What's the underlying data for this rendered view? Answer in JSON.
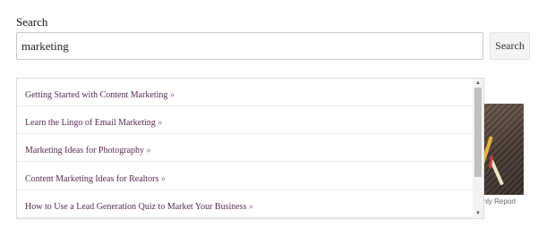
{
  "search": {
    "label": "Search",
    "value": "marketing",
    "button_label": "Search"
  },
  "suggestions": [
    {
      "title": "Getting Started with Content Marketing",
      "chevron": "»"
    },
    {
      "title": "Learn the Lingo of Email Marketing",
      "chevron": "»"
    },
    {
      "title": "Marketing Ideas for Photography",
      "chevron": "»"
    },
    {
      "title": "Content Marketing Ideas for Realtors",
      "chevron": "»"
    },
    {
      "title": "How to Use a Lead Generation Quiz to Market Your Business",
      "chevron": "»"
    }
  ],
  "scrollbar": {
    "up_arrow": "▲",
    "down_arrow": "▼",
    "scroll_fraction": 0.0
  },
  "background_card": {
    "caption": "nthly Report"
  },
  "colors": {
    "link": "#5a2a55",
    "border": "#c8c8c8",
    "button_bg": "#f4f4f4"
  }
}
